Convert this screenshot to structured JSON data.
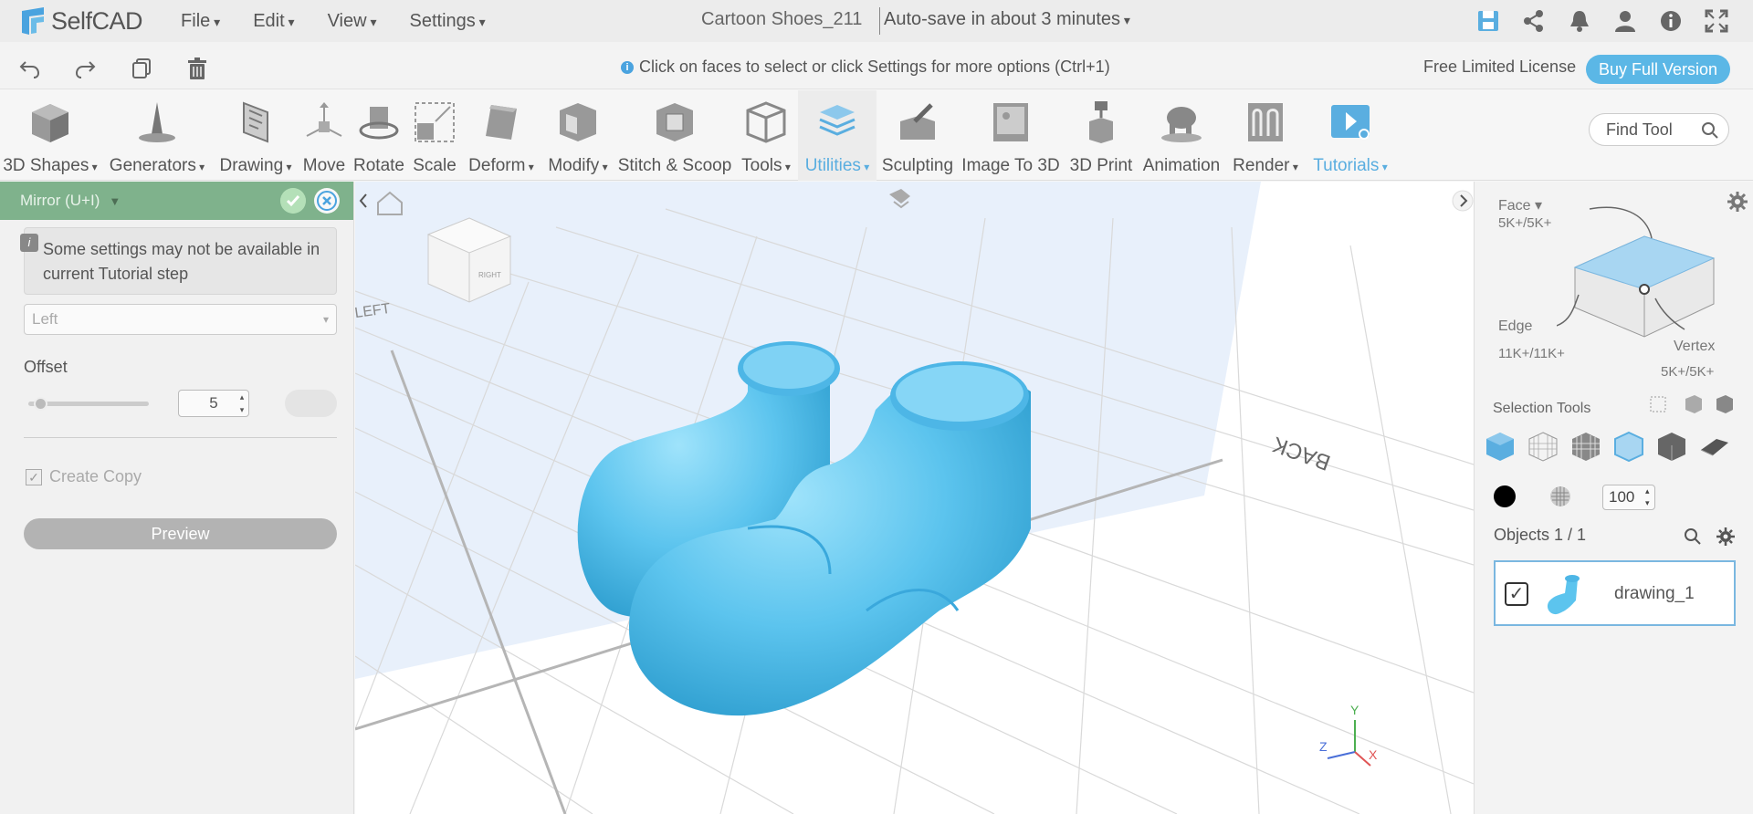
{
  "app": {
    "name": "SelfCAD"
  },
  "menus": [
    "File",
    "Edit",
    "View",
    "Settings"
  ],
  "document": {
    "title": "Cartoon Shoes_211",
    "autosave": "Auto-save in about 3 minutes"
  },
  "hint": "Click on faces to select or click Settings for more options (Ctrl+1)",
  "license": {
    "text": "Free Limited License",
    "buy": "Buy Full Version"
  },
  "tools": [
    "3D Shapes",
    "Generators",
    "Drawing",
    "Move",
    "Rotate",
    "Scale",
    "Deform",
    "Modify",
    "Stitch & Scoop",
    "Tools",
    "Utilities",
    "Sculpting",
    "Image To 3D",
    "3D Print",
    "Animation",
    "Render",
    "Tutorials"
  ],
  "find_tool": {
    "placeholder": "Find Tool"
  },
  "panel": {
    "title": "Mirror (U+I)",
    "note": "Some settings may not be available in current Tutorial step",
    "direction": "Left",
    "offset_label": "Offset",
    "offset_value": "5",
    "create_copy": "Create Copy",
    "preview": "Preview"
  },
  "viewport": {
    "cube_labels": [
      "RIGHT",
      "LEFT",
      "BACK"
    ],
    "axes": [
      "Y",
      "Z",
      "X"
    ]
  },
  "right_panel": {
    "face": "Face",
    "face_count": "5K+/5K+",
    "edge": "Edge",
    "edge_count": "11K+/11K+",
    "vertex": "Vertex",
    "vertex_count": "5K+/5K+",
    "selection_tools": "Selection Tools",
    "opacity": "100",
    "objects_label": "Objects 1 / 1",
    "object_name": "drawing_1"
  },
  "colors": {
    "accent": "#5bb7e6",
    "panel_header": "#7fb28c",
    "model": "#5cc4ee"
  }
}
